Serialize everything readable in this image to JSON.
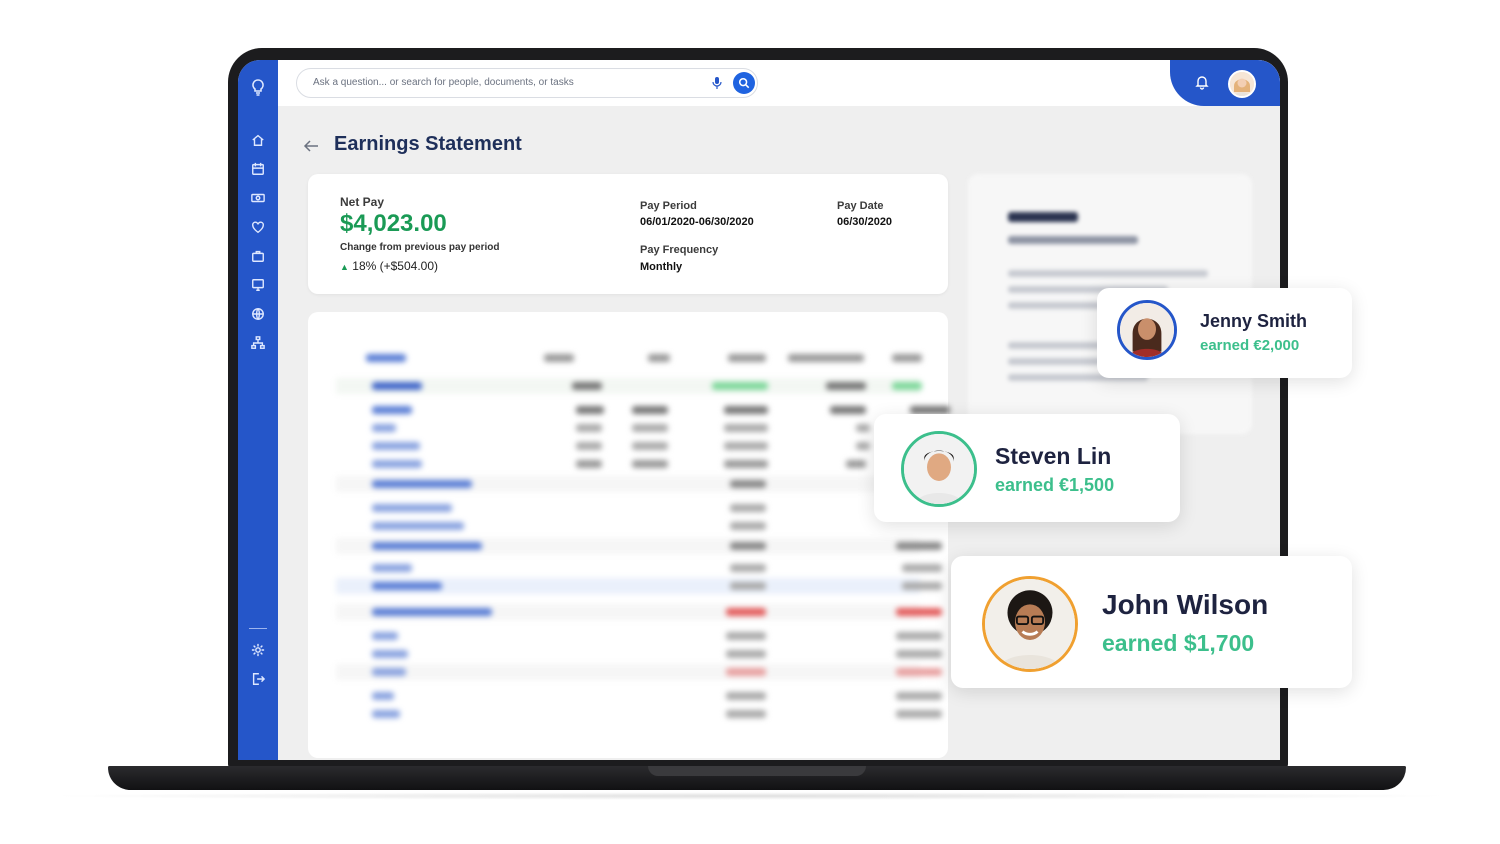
{
  "search": {
    "placeholder": "Ask a question... or search for people, documents, or tasks"
  },
  "sidebar": {
    "items": [
      {
        "icon": "lightbulb-icon"
      },
      {
        "icon": "home-icon"
      },
      {
        "icon": "calendar-icon"
      },
      {
        "icon": "money-icon"
      },
      {
        "icon": "benefits-icon"
      },
      {
        "icon": "briefcase-icon"
      },
      {
        "icon": "monitor-icon"
      },
      {
        "icon": "globe-icon"
      },
      {
        "icon": "org-chart-icon"
      },
      {
        "icon": "settings-icon"
      },
      {
        "icon": "logout-icon"
      }
    ]
  },
  "page": {
    "title": "Earnings Statement"
  },
  "net_pay": {
    "label": "Net Pay",
    "amount": "$4,023.00",
    "change_label": "Change from previous pay period",
    "change_value": "18%  (+$504.00)",
    "pay_period_label": "Pay Period",
    "pay_period_value": "06/01/2020-06/30/2020",
    "pay_date_label": "Pay Date",
    "pay_date_value": "06/30/2020",
    "pay_frequency_label": "Pay Frequency",
    "pay_frequency_value": "Monthly"
  },
  "earners": [
    {
      "name": "Jenny Smith",
      "earned": "earned €2,000",
      "ring_color": "#2556c9"
    },
    {
      "name": "Steven Lin",
      "earned": "earned €1,500",
      "ring_color": "#3cbf8c"
    },
    {
      "name": "John Wilson",
      "earned": "earned $1,700",
      "ring_color": "#f0a030"
    }
  ],
  "colors": {
    "brand_blue": "#2556c9",
    "positive_green": "#1a9a55",
    "earned_green": "#3cbf8c",
    "title_navy": "#1e2f5a"
  }
}
